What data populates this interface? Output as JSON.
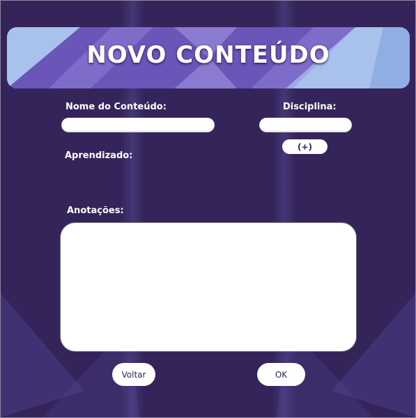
{
  "header": {
    "title": "NOVO CONTEÚDO"
  },
  "form": {
    "content_name_label": "Nome do Conteúdo:",
    "content_name_value": "",
    "discipline_label": "Disciplina:",
    "discipline_value": "",
    "add_discipline_label": "(+)",
    "learning_label": "Aprendizado:",
    "notes_label": "Anotações:",
    "notes_value": ""
  },
  "actions": {
    "back_label": "Voltar",
    "ok_label": "OK"
  },
  "colors": {
    "background": "#34245a",
    "banner_light": "#a9c2ec",
    "banner_purple": "#6a55b8",
    "input_fill": "#ffffff"
  }
}
